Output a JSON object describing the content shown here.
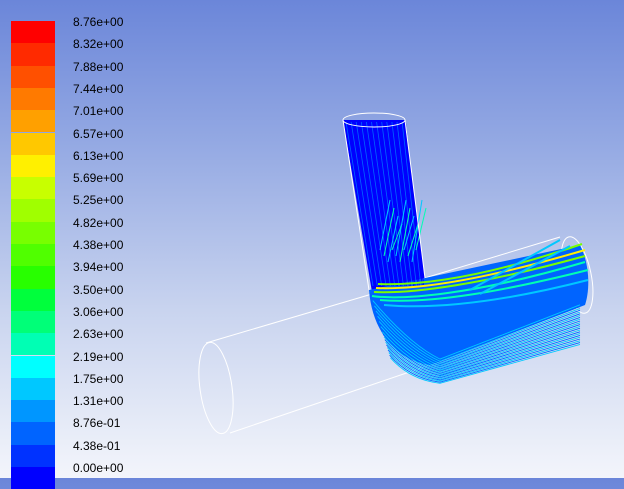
{
  "legend": {
    "labels": [
      "8.76e+00",
      "8.32e+00",
      "7.88e+00",
      "7.44e+00",
      "7.01e+00",
      "6.57e+00",
      "6.13e+00",
      "5.69e+00",
      "5.25e+00",
      "4.82e+00",
      "4.38e+00",
      "3.94e+00",
      "3.50e+00",
      "3.06e+00",
      "2.63e+00",
      "2.19e+00",
      "1.75e+00",
      "1.31e+00",
      "8.76e-01",
      "4.38e-01",
      "0.00e+00"
    ],
    "colors": [
      "#ff0000",
      "#ff2a00",
      "#ff5000",
      "#ff7a00",
      "#ffa000",
      "#ffc800",
      "#fff000",
      "#c8ff00",
      "#a0ff00",
      "#78ff00",
      "#50ff00",
      "#28ff00",
      "#00ff3c",
      "#00ff78",
      "#00ffb4",
      "#00ffff",
      "#00c8ff",
      "#0096ff",
      "#0064ff",
      "#0032ff",
      "#0000ff"
    ]
  },
  "scene": {
    "outline_color": "#ffffff",
    "flow_colors": [
      "#0000ff",
      "#0064ff",
      "#00c8ff",
      "#00ffb4",
      "#78ff00",
      "#fff000"
    ]
  }
}
